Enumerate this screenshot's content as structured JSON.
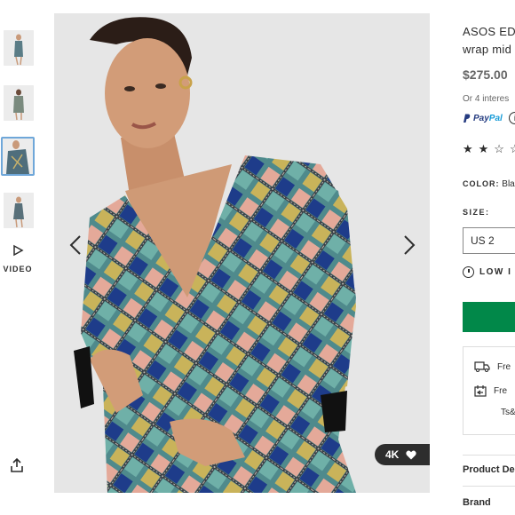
{
  "gallery": {
    "video_label": "VIDEO",
    "likes_count": "4K"
  },
  "product": {
    "title_line1": "ASOS ED",
    "title_line2": "wrap mid",
    "price": "$275.00",
    "installments": "Or 4 interes",
    "paypal_pay": "Pay",
    "paypal_pal": "Pal",
    "rating_stars": "★★☆☆",
    "color_label": "COLOR:",
    "color_value": "Bla",
    "size_label": "SIZE:",
    "size_value": "US 2",
    "stock_notice": "LOW I",
    "shipping_1": "Fre",
    "shipping_2": "Fre",
    "shipping_3": "Ts&",
    "accordion_1": "Product De",
    "accordion_2": "Brand"
  },
  "colors": {
    "accent_blue": "#6fa7d9",
    "add_button_green": "#018849",
    "paypal_dark": "#253b80",
    "paypal_light": "#179bd7"
  }
}
